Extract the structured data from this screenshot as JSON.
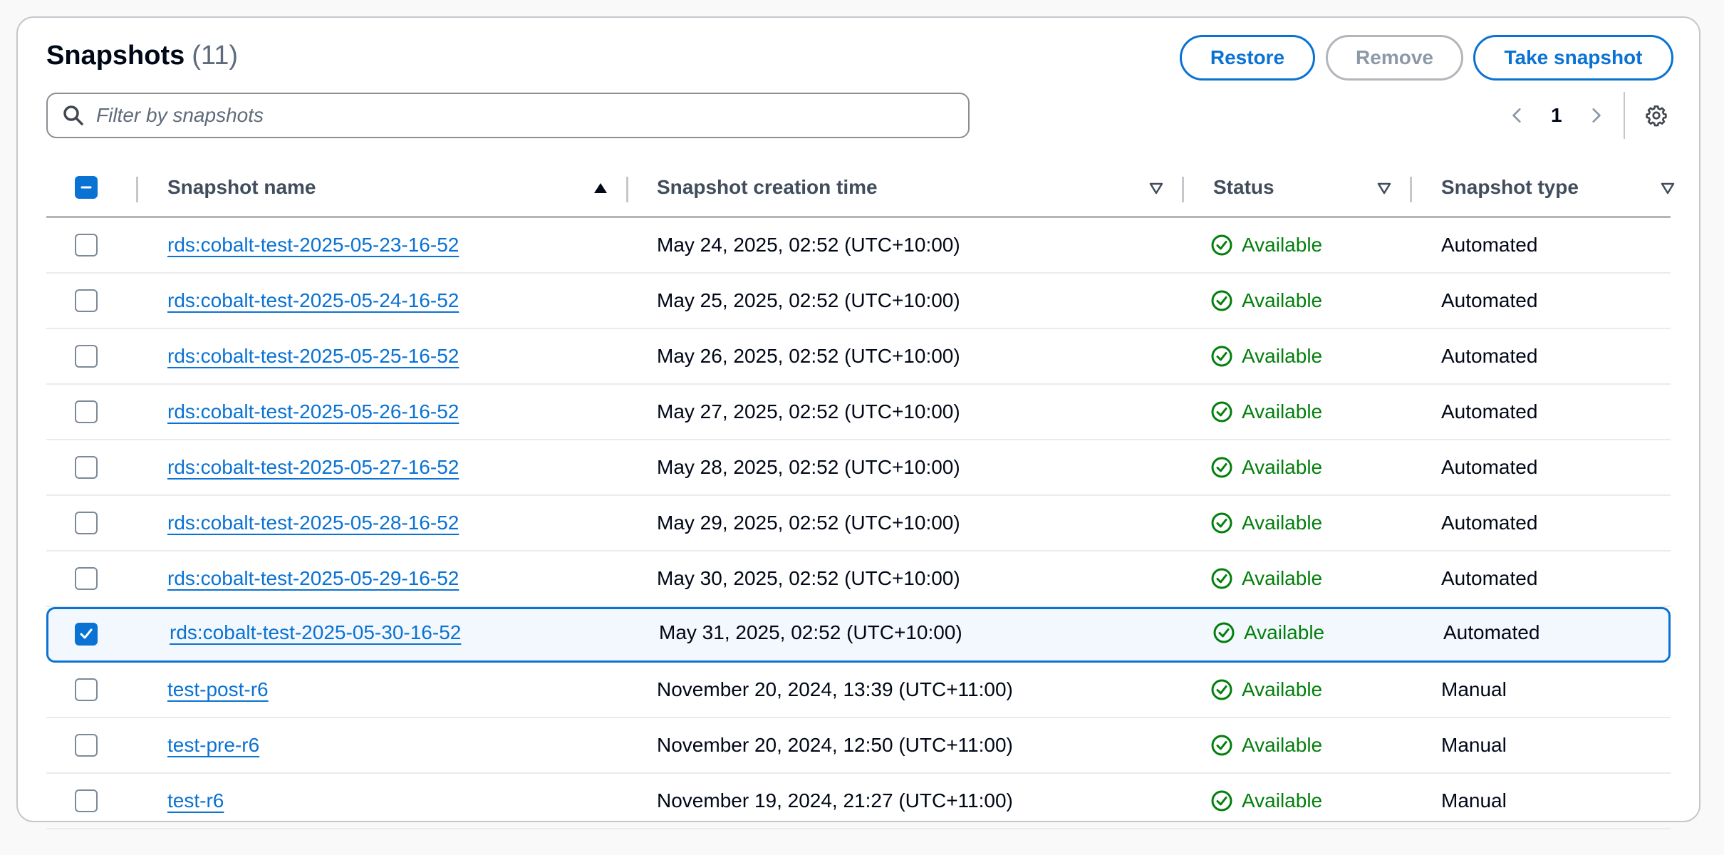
{
  "header": {
    "title": "Snapshots",
    "count": "(11)"
  },
  "actions": {
    "restore": "Restore",
    "remove": "Remove",
    "take_snapshot": "Take snapshot"
  },
  "search": {
    "placeholder": "Filter by snapshots"
  },
  "pagination": {
    "current_page": "1"
  },
  "columns": {
    "name": "Snapshot name",
    "time": "Snapshot creation time",
    "status": "Status",
    "type": "Snapshot type"
  },
  "rows": [
    {
      "name": "rds:cobalt-test-2025-05-23-16-52",
      "time": "May 24, 2025, 02:52 (UTC+10:00)",
      "status": "Available",
      "type": "Automated",
      "selected": false
    },
    {
      "name": "rds:cobalt-test-2025-05-24-16-52",
      "time": "May 25, 2025, 02:52 (UTC+10:00)",
      "status": "Available",
      "type": "Automated",
      "selected": false
    },
    {
      "name": "rds:cobalt-test-2025-05-25-16-52",
      "time": "May 26, 2025, 02:52 (UTC+10:00)",
      "status": "Available",
      "type": "Automated",
      "selected": false
    },
    {
      "name": "rds:cobalt-test-2025-05-26-16-52",
      "time": "May 27, 2025, 02:52 (UTC+10:00)",
      "status": "Available",
      "type": "Automated",
      "selected": false
    },
    {
      "name": "rds:cobalt-test-2025-05-27-16-52",
      "time": "May 28, 2025, 02:52 (UTC+10:00)",
      "status": "Available",
      "type": "Automated",
      "selected": false
    },
    {
      "name": "rds:cobalt-test-2025-05-28-16-52",
      "time": "May 29, 2025, 02:52 (UTC+10:00)",
      "status": "Available",
      "type": "Automated",
      "selected": false
    },
    {
      "name": "rds:cobalt-test-2025-05-29-16-52",
      "time": "May 30, 2025, 02:52 (UTC+10:00)",
      "status": "Available",
      "type": "Automated",
      "selected": false
    },
    {
      "name": "rds:cobalt-test-2025-05-30-16-52",
      "time": "May 31, 2025, 02:52 (UTC+10:00)",
      "status": "Available",
      "type": "Automated",
      "selected": true
    },
    {
      "name": "test-post-r6",
      "time": "November 20, 2024, 13:39 (UTC+11:00)",
      "status": "Available",
      "type": "Manual",
      "selected": false
    },
    {
      "name": "test-pre-r6",
      "time": "November 20, 2024, 12:50 (UTC+11:00)",
      "status": "Available",
      "type": "Manual",
      "selected": false
    },
    {
      "name": "test-r6",
      "time": "November 19, 2024, 21:27 (UTC+11:00)",
      "status": "Available",
      "type": "Manual",
      "selected": false
    }
  ],
  "icons": {
    "search": "search-icon",
    "prev": "chevron-left-icon",
    "next": "chevron-right-icon",
    "settings": "gear-icon",
    "status": "check-circle-icon",
    "sort_asc": "sort-ascending-icon",
    "sort": "sort-icon"
  },
  "colors": {
    "accent": "#0972d3",
    "success": "#037f0c",
    "selected_bg": "#f2f8fd"
  }
}
